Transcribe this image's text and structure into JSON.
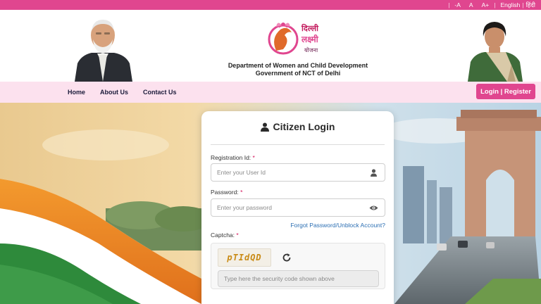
{
  "topbar": {
    "font_decrease": "-A",
    "font_normal": "A",
    "font_increase": "A+",
    "lang_english": "English",
    "lang_separator": "|",
    "lang_hindi": "हिंदी"
  },
  "header": {
    "logo_text_line1": "दिल्ली",
    "logo_text_line2": "लक्ष्मी",
    "logo_text_line3": "योजना",
    "department": "Department of Women and Child Development",
    "government": "Government of NCT of Delhi"
  },
  "nav": {
    "items": [
      "Home",
      "About Us",
      "Contact Us"
    ],
    "login_button": "Login | Register"
  },
  "login": {
    "title": "Citizen Login",
    "registration_label": "Registration Id:",
    "registration_placeholder": "Enter your User Id",
    "password_label": "Password:",
    "password_placeholder": "Enter your password",
    "forgot_link": "Forgot Password/Unblock Account?",
    "captcha_label": "Captcha:",
    "captcha_code": "pTIdQD",
    "captcha_placeholder": "Type here the security code shown above",
    "required_mark": "*"
  },
  "colors": {
    "brand_pink": "#e0468f",
    "nav_bg": "#fce1ee",
    "link_blue": "#2c6fb3"
  },
  "icons": {
    "user": "user-icon",
    "eye": "eye-icon",
    "refresh": "refresh-icon",
    "person_title": "person-icon"
  }
}
